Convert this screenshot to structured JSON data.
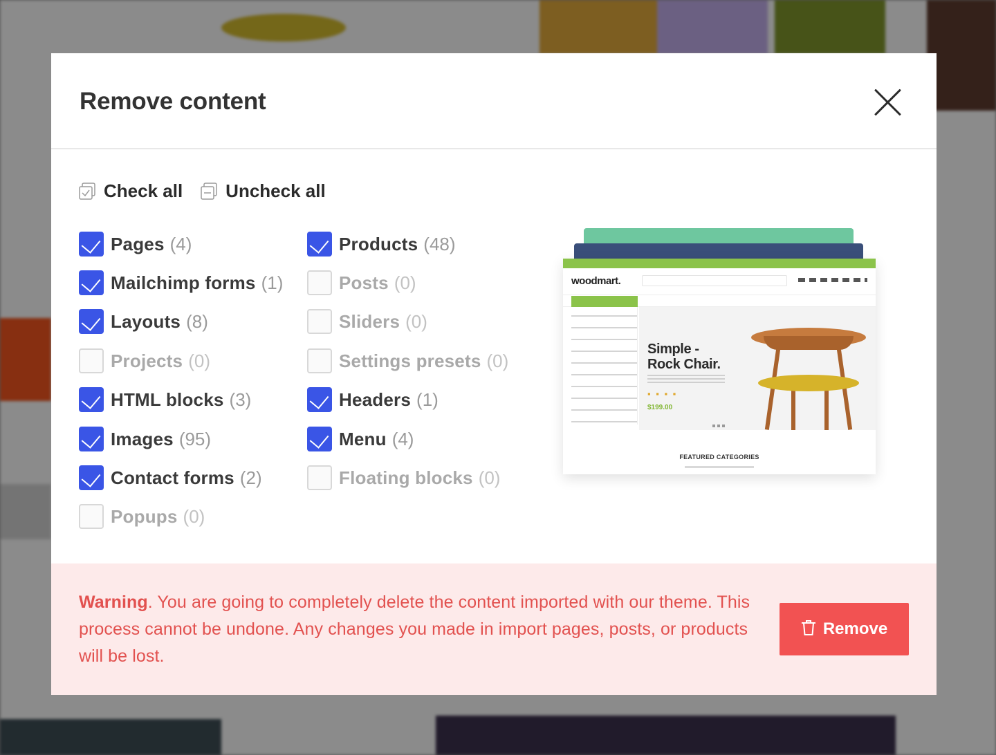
{
  "modal": {
    "title": "Remove content",
    "check_all_label": "Check all",
    "uncheck_all_label": "Uncheck all"
  },
  "options": {
    "left": [
      {
        "label": "Pages",
        "count": "(4)",
        "checked": true
      },
      {
        "label": "Mailchimp forms",
        "count": "(1)",
        "checked": true
      },
      {
        "label": "Layouts",
        "count": "(8)",
        "checked": true
      },
      {
        "label": "Projects",
        "count": "(0)",
        "checked": false
      },
      {
        "label": "HTML blocks",
        "count": "(3)",
        "checked": true
      },
      {
        "label": "Images",
        "count": "(95)",
        "checked": true
      },
      {
        "label": "Contact forms",
        "count": "(2)",
        "checked": true
      },
      {
        "label": "Popups",
        "count": "(0)",
        "checked": false
      }
    ],
    "right": [
      {
        "label": "Products",
        "count": "(48)",
        "checked": true
      },
      {
        "label": "Posts",
        "count": "(0)",
        "checked": false
      },
      {
        "label": "Sliders",
        "count": "(0)",
        "checked": false
      },
      {
        "label": "Settings presets",
        "count": "(0)",
        "checked": false
      },
      {
        "label": "Headers",
        "count": "(1)",
        "checked": true
      },
      {
        "label": "Menu",
        "count": "(4)",
        "checked": true
      },
      {
        "label": "Floating blocks",
        "count": "(0)",
        "checked": false
      }
    ]
  },
  "preview": {
    "logo": "woodmart.",
    "headline_line1": "Simple -",
    "headline_line2": "Rock Chair.",
    "price": "$199.00",
    "featured": "FEATURED CATEGORIES"
  },
  "warning": {
    "strong": "Warning",
    "text": ". You are going to completely delete the content imported with our theme. This process cannot be undone. Any changes you made in import pages, posts, or products will be lost."
  },
  "remove_button": {
    "label": "Remove"
  },
  "colors": {
    "checkbox_checked": "#3a55e6",
    "warning_text": "#e2514f",
    "warning_bg": "#fdeaea",
    "remove_button": "#f25252"
  }
}
